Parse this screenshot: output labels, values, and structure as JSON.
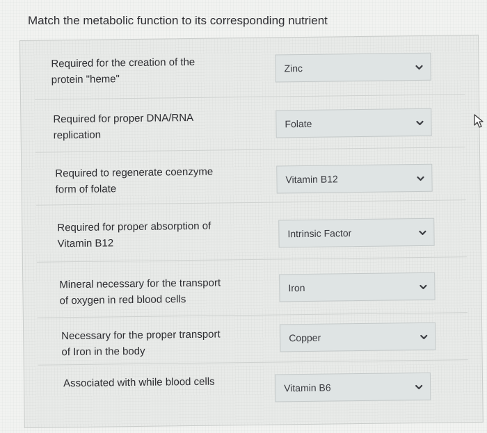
{
  "question": {
    "title": "Match the metabolic function to its corresponding nutrient"
  },
  "items": [
    {
      "prompt_line1": "Required for the creation of the",
      "prompt_line2": "protein \"heme\"",
      "selected": "Zinc"
    },
    {
      "prompt_line1": "Required for proper DNA/RNA",
      "prompt_line2": "replication",
      "selected": "Folate"
    },
    {
      "prompt_line1": "Required to regenerate coenzyme",
      "prompt_line2": "form of folate",
      "selected": "Vitamin B12"
    },
    {
      "prompt_line1": "Required for proper absorption of",
      "prompt_line2": "Vitamin B12",
      "selected": "Intrinsic Factor"
    },
    {
      "prompt_line1": "Mineral necessary for the transport",
      "prompt_line2": "of oxygen in red blood cells",
      "selected": "Iron"
    },
    {
      "prompt_line1": "Necessary for the proper transport",
      "prompt_line2": "of Iron in the body",
      "selected": "Copper"
    },
    {
      "prompt_line1": "Associated with while blood cells",
      "prompt_line2": "",
      "selected": "Vitamin B6"
    }
  ],
  "icons": {
    "dropdown": "chevron-down-icon",
    "cursor": "mouse-pointer-icon"
  },
  "colors": {
    "page_background": "#f2f3f1",
    "panel_background": "#e9ebe9",
    "dropdown_background": "#dfe4e4",
    "text": "#2d2d31"
  }
}
